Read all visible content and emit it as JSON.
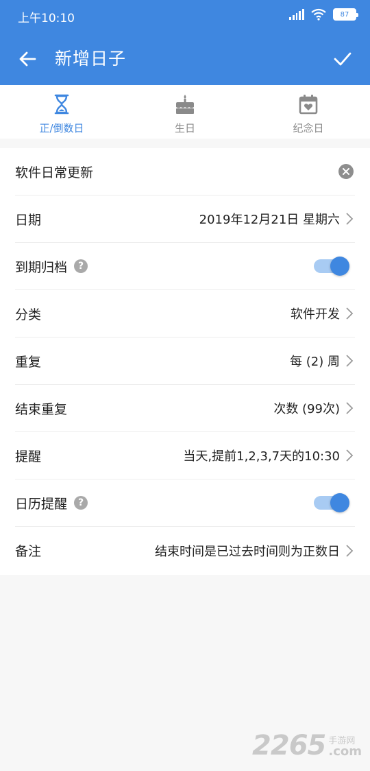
{
  "status_bar": {
    "time": "上午10:10",
    "battery": "87"
  },
  "app_bar": {
    "title": "新增日子"
  },
  "tabs": [
    {
      "label": "正/倒数日",
      "icon": "hourglass-icon",
      "active": true
    },
    {
      "label": "生日",
      "icon": "cake-icon",
      "active": false
    },
    {
      "label": "纪念日",
      "icon": "calendar-heart-icon",
      "active": false
    }
  ],
  "form": {
    "name": "软件日常更新",
    "date": {
      "label": "日期",
      "value": "2019年12月21日 星期六"
    },
    "archive": {
      "label": "到期归档",
      "enabled": true
    },
    "category": {
      "label": "分类",
      "value": "软件开发"
    },
    "repeat": {
      "label": "重复",
      "value": "每 (2) 周"
    },
    "end_repeat": {
      "label": "结束重复",
      "value": "次数 (99次)"
    },
    "reminder": {
      "label": "提醒",
      "value": "当天,提前1,2,3,7天的10:30"
    },
    "calendar_reminder": {
      "label": "日历提醒",
      "enabled": true
    },
    "note": {
      "label": "备注",
      "value": "结束时间是已过去时间则为正数日"
    }
  },
  "watermark": {
    "number": "2265",
    "site_top": "手游网",
    "site_bottom": ".com"
  },
  "colors": {
    "primary": "#3f87e0",
    "toggle_track": "#a8cbf3"
  }
}
